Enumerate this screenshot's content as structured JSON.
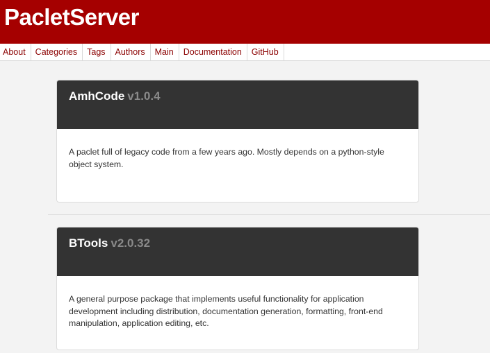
{
  "site": {
    "title": "PacletServer",
    "brand_color": "#a50000"
  },
  "nav": {
    "items": [
      {
        "label": "About"
      },
      {
        "label": "Categories"
      },
      {
        "label": "Tags"
      },
      {
        "label": "Authors"
      },
      {
        "label": "Main"
      },
      {
        "label": "Documentation"
      },
      {
        "label": "GitHub"
      }
    ]
  },
  "paclets": [
    {
      "name": "AmhCode",
      "version": "v1.0.4",
      "description": "A paclet full of legacy code from a few years ago. Mostly depends on a python-style object system."
    },
    {
      "name": "BTools",
      "version": "v2.0.32",
      "description": "A general purpose package that implements useful functionality for application development including distribution, documentation generation, formatting, front-end manipulation, application editing, etc."
    }
  ]
}
